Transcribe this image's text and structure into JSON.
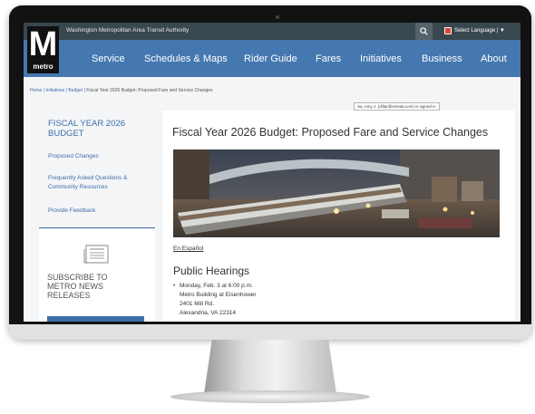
{
  "header": {
    "org_name": "Washington Metropolitan Area Transit Authority",
    "language_label": "Select Language | ▼",
    "logo_letter": "M",
    "logo_word": "metro"
  },
  "nav": {
    "items": [
      "Service",
      "Schedules & Maps",
      "Rider Guide",
      "Fares",
      "Initiatives",
      "Business",
      "About"
    ]
  },
  "breadcrumb": {
    "items": [
      "Home",
      "Initiatives",
      "Budget"
    ],
    "current": "Fiscal Year 2026 Budget: Proposed Fare and Service Changes",
    "separator": " | "
  },
  "signed_in": "Sa, Amy J. (dillar@wmata.com) is signed in",
  "sidebar": {
    "title_line1": "FISCAL YEAR 2026",
    "title_line2": "BUDGET",
    "links": [
      "Proposed Changes",
      "Frequently Asked Questions &",
      "Community Resources",
      "Provide Feedback"
    ],
    "subscribe_line1": "SUBSCRIBE TO",
    "subscribe_line2": "METRO NEWS",
    "subscribe_line3": "RELEASES"
  },
  "main": {
    "title": "Fiscal Year 2026 Budget: Proposed Fare and Service Changes",
    "espanol_link": "En Español",
    "hearings_heading": "Public Hearings",
    "hearing_item": {
      "line1": "Monday, Feb. 3 at 6:00 p.m.",
      "line2": "Metro Building at Eisenhower",
      "line3": "2401 Mill Rd.",
      "line4": "Alexandria, VA 22314"
    }
  },
  "colors": {
    "nav_blue": "#4578b0",
    "topbar": "#39474f",
    "link_blue": "#3d6ea8",
    "bezel": "#121212"
  }
}
